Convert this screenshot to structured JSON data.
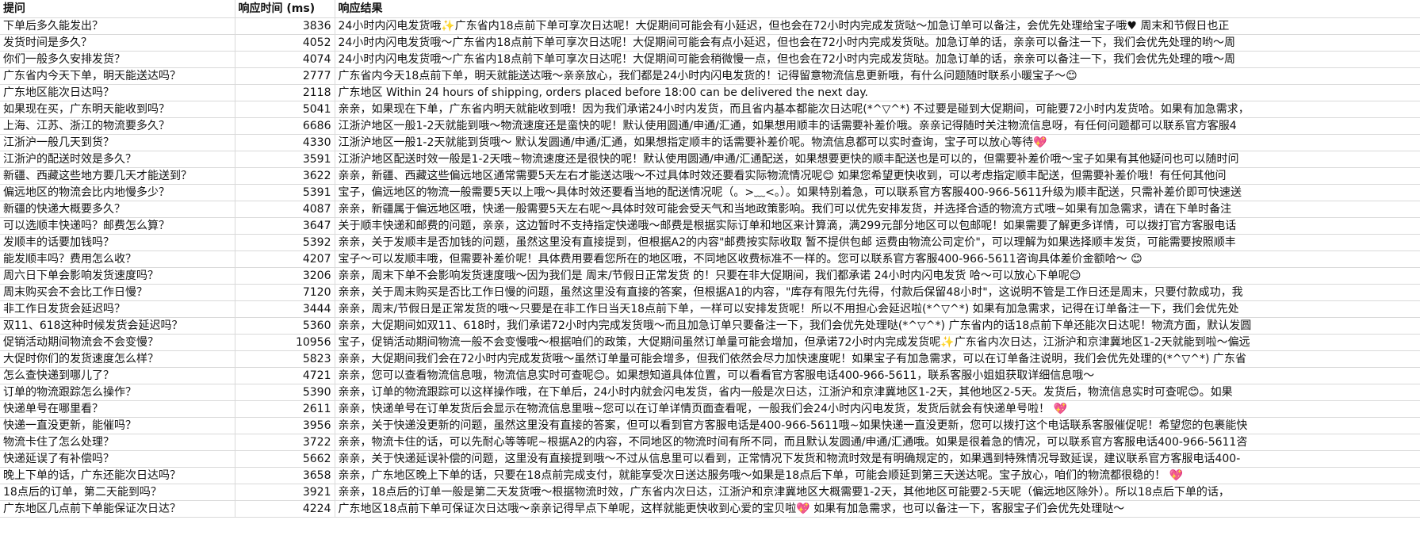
{
  "headers": {
    "question": "提问",
    "time": "响应时间 (ms)",
    "result": "响应结果"
  },
  "rows": [
    {
      "q": "下单后多久能发出？",
      "t": "3836",
      "r": "24小时内闪电发货哦✨广东省内18点前下单可享次日达呢！大促期间可能会有小延迟，但也会在72小时内完成发货哒～加急订单可以备注，会优先处理给宝子哦♥   周末和节假日也正"
    },
    {
      "q": "发货时间是多久？",
      "t": "4052",
      "r": "24小时内闪电发货哦～广东省内18点前下单可享次日达呢！大促期间可能会有点小延迟，但也会在72小时内完成发货哒。加急订单的话，亲亲可以备注一下，我们会优先处理的哟～周"
    },
    {
      "q": "你们一般多久安排发货？",
      "t": "4074",
      "r": "24小时内闪电发货哦～广东省内18点前下单可享次日达呢！大促期间可能会稍微慢一点，但也会在72小时内完成发货哒。加急订单的话，亲亲可以备注一下，我们会优先处理的哦～周"
    },
    {
      "q": "广东省内今天下单，明天能送达吗？",
      "t": "2777",
      "r": "广东省内今天18点前下单，明天就能送达哦～亲亲放心，我们都是24小时内闪电发货的！记得留意物流信息更新哦，有什么问题随时联系小暖宝子～😊"
    },
    {
      "q": "广东地区能次日达吗？",
      "t": "2118",
      "r": "广东地区 Within 24 hours of shipping, orders placed before 18:00 can be delivered the next day."
    },
    {
      "q": "如果现在买，广东明天能收到吗？",
      "t": "5041",
      "r": "亲亲，如果现在下单，广东省内明天就能收到哦！因为我们承诺24小时内发货，而且省内基本都能次日达呢(*^▽^*) 不过要是碰到大促期间，可能要72小时内发货哈。如果有加急需求，"
    },
    {
      "q": "上海、江苏、浙江的物流要多久？",
      "t": "6686",
      "r": "江浙沪地区一般1-2天就能到哦～物流速度还是蛮快的呢！默认使用圆通/申通/汇通，如果想用顺丰的话需要补差价哦。亲亲记得随时关注物流信息呀，有任何问题都可以联系官方客服4"
    },
    {
      "q": "江浙沪一般几天到货？",
      "t": "4330",
      "r": "江浙沪地区一般1-2天就能到货哦～ 默认发圆通/申通/汇通，如果想指定顺丰的话需要补差价呢。物流信息都可以实时查询，宝子可以放心等待💖"
    },
    {
      "q": "江浙沪的配送时效是多久？",
      "t": "3591",
      "r": "江浙沪地区配送时效一般是1-2天哦~物流速度还是很快的呢！默认使用圆通/申通/汇通配送，如果想要更快的顺丰配送也是可以的，但需要补差价哦～宝子如果有其他疑问也可以随时问"
    },
    {
      "q": "新疆、西藏这些地方要几天才能送到？",
      "t": "3622",
      "r": "亲亲，新疆、西藏这些偏远地区通常需要5天左右才能送达哦～不过具体时效还要看实际物流情况呢😊 如果您希望更快收到，可以考虑指定顺丰配送，但需要补差价哦！有任何其他问"
    },
    {
      "q": "偏远地区的物流会比内地慢多少？",
      "t": "5391",
      "r": "宝子，偏远地区的物流一般需要5天以上哦～具体时效还要看当地的配送情况呢（。>﹏<。）。如果特别着急，可以联系官方客服400-966-5611升级为顺丰配送，只需补差价即可快速送"
    },
    {
      "q": "新疆的快递大概要多久？",
      "t": "4087",
      "r": "亲亲，新疆属于偏远地区哦，快递一般需要5天左右呢～具体时效可能会受天气和当地政策影响。我们可以优先安排发货，并选择合适的物流方式哦~如果有加急需求，请在下单时备注"
    },
    {
      "q": "可以选顺丰快递吗？邮费怎么算？",
      "t": "3647",
      "r": "关于顺丰快递和邮费的问题，亲亲，这边暂时不支持指定快递哦～邮费是根据实际订单和地区来计算滴，满299元部分地区可以包邮呢！如果需要了解更多详情，可以拨打官方客服电话"
    },
    {
      "q": "发顺丰的话要加钱吗？",
      "t": "5392",
      "r": "亲亲，关于发顺丰是否加钱的问题，虽然这里没有直接提到，但根据A2的内容\"邮费按实际收取 暂不提供包邮 运费由物流公司定价\"，可以理解为如果选择顺丰发货，可能需要按照顺丰"
    },
    {
      "q": "能发顺丰吗？费用怎么收？",
      "t": "4207",
      "r": "宝子～可以发顺丰哦，但需要补差价呢！具体费用要看您所在的地区哦，不同地区收费标准不一样的。您可以联系官方客服400-966-5611咨询具体差价金额哈～ 😊"
    },
    {
      "q": "周六日下单会影响发货速度吗？",
      "t": "3206",
      "r": "亲亲，周末下单不会影响发货速度哦～因为我们是 周末/节假日正常发货 的！只要在非大促期间，我们都承诺 24小时内闪电发货 哈～可以放心下单呢😊"
    },
    {
      "q": "周末购买会不会比工作日慢？",
      "t": "7120",
      "r": "亲亲，关于周末购买是否比工作日慢的问题，虽然这里没有直接的答案，但根据A1的内容，\"库存有限先付先得，付款后保留48小时\"，这说明不管是工作日还是周末，只要付款成功，我"
    },
    {
      "q": "非工作日发货会延迟吗？",
      "t": "3444",
      "r": "亲亲，周末/节假日是正常发货的哦～只要是在非工作日当天18点前下单，一样可以安排发货呢！所以不用担心会延迟啦(*^▽^*) 如果有加急需求，记得在订单备注一下，我们会优先处"
    },
    {
      "q": "双11、618这种时候发货会延迟吗？",
      "t": "5360",
      "r": "亲亲，大促期间如双11、618时，我们承诺72小时内完成发货哦～而且加急订单只要备注一下，我们会优先处理哒(*^▽^*) 广东省内的话18点前下单还能次日达呢！物流方面，默认发圆"
    },
    {
      "q": "促销活动期间物流会不会变慢？",
      "t": "10956",
      "r": "宝子，促销活动期间物流一般不会变慢哦～根据咱们的政策，大促期间虽然订单量可能会增加，但承诺72小时内完成发货呢✨广东省内次日达，江浙沪和京津冀地区1-2天就能到啦～偏远"
    },
    {
      "q": "大促时你们的发货速度怎么样？",
      "t": "5823",
      "r": "亲亲，大促期间我们会在72小时内完成发货哦～虽然订单量可能会增多，但我们依然会尽力加快速度呢！如果宝子有加急需求，可以在订单备注说明，我们会优先处理的(*^▽^*) 广东省"
    },
    {
      "q": "怎么查快递到哪儿了？",
      "t": "4721",
      "r": "亲亲，您可以查看物流信息哦，物流信息实时可查呢😊。如果想知道具体位置，可以看看官方客服电话400-966-5611，联系客服小姐姐获取详细信息哦～"
    },
    {
      "q": "订单的物流跟踪怎么操作？",
      "t": "5390",
      "r": "亲亲，订单的物流跟踪可以这样操作哦，在下单后，24小时内就会闪电发货，省内一般是次日达，江浙沪和京津冀地区1-2天，其他地区2-5天。发货后，物流信息实时可查呢😊。如果"
    },
    {
      "q": "快递单号在哪里看？",
      "t": "2611",
      "r": "亲亲，快递单号在订单发货后会显示在物流信息里哦~您可以在订单详情页面查看呢，一般我们会24小时内闪电发货，发货后就会有快递单号啦！ 💖"
    },
    {
      "q": "快递一直没更新，能催吗？",
      "t": "3956",
      "r": "亲亲，关于快递没更新的问题，虽然这里没有直接的答案，但可以看到官方客服电话是400-966-5611哦~如果快递一直没更新，您可以拨打这个电话联系客服催促呢！希望您的包裹能快"
    },
    {
      "q": "物流卡住了怎么处理？",
      "t": "3722",
      "r": "亲亲，物流卡住的话，可以先耐心等等呢~根据A2的内容，不同地区的物流时间有所不同，而且默认发圆通/申通/汇通哦。如果是很着急的情况，可以联系官方客服电话400-966-5611咨"
    },
    {
      "q": "快递延误了有补偿吗？",
      "t": "5662",
      "r": "亲亲，关于快递延误补偿的问题，这里没有直接提到哦～不过从信息里可以看到，正常情况下发货和物流时效是有明确规定的，如果遇到特殊情况导致延误，建议联系官方客服电话400-"
    },
    {
      "q": "晚上下单的话，广东还能次日达吗？",
      "t": "3658",
      "r": "亲亲，广东地区晚上下单的话，只要在18点前完成支付，就能享受次日送达服务哦～如果是18点后下单，可能会顺延到第三天送达呢。宝子放心，咱们的物流都很稳的！ 💖"
    },
    {
      "q": "18点后的订单，第二天能到吗？",
      "t": "3921",
      "r": "亲亲，18点后的订单一般是第二天发货哦～根据物流时效，广东省内次日达，江浙沪和京津冀地区大概需要1-2天，其他地区可能要2-5天呢（偏远地区除外）。所以18点后下单的话，"
    },
    {
      "q": "广东地区几点前下单能保证次日达？",
      "t": "4224",
      "r": "广东地区18点前下单可保证次日达哦～亲亲记得早点下单呢，这样就能更快收到心爱的宝贝啦💖 如果有加急需求，也可以备注一下，客服宝子们会优先处理哒～"
    }
  ]
}
